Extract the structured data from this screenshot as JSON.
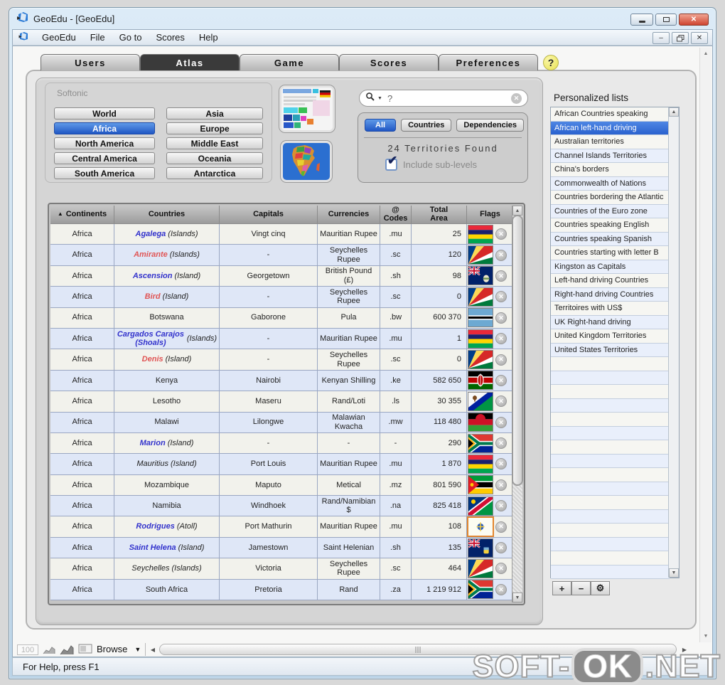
{
  "window": {
    "title": "GeoEdu - [GeoEdu]",
    "menu_items": [
      "GeoEdu",
      "File",
      "Go to",
      "Scores",
      "Help"
    ],
    "status_text": "For Help, press F1"
  },
  "tabs": [
    {
      "label": "Users",
      "active": false
    },
    {
      "label": "Atlas",
      "active": true
    },
    {
      "label": "Game",
      "active": false
    },
    {
      "label": "Scores",
      "active": false
    },
    {
      "label": "Preferences",
      "active": false
    }
  ],
  "help_label": "?",
  "atlas": {
    "brand_watermark": "Softonic",
    "regions": [
      {
        "label": "World",
        "selected": false
      },
      {
        "label": "Asia",
        "selected": false
      },
      {
        "label": "Africa",
        "selected": true
      },
      {
        "label": "Europe",
        "selected": false
      },
      {
        "label": "North America",
        "selected": false
      },
      {
        "label": "Middle East",
        "selected": false
      },
      {
        "label": "Central America",
        "selected": false
      },
      {
        "label": "Oceania",
        "selected": false
      },
      {
        "label": "South America",
        "selected": false
      },
      {
        "label": "Antarctica",
        "selected": false
      }
    ],
    "search": {
      "value": "?",
      "filters": [
        {
          "label": "All",
          "selected": true
        },
        {
          "label": "Countries",
          "selected": false
        },
        {
          "label": "Dependencies",
          "selected": false
        }
      ],
      "result_text": "24 Territories Found",
      "include_sublevels_label": "Include sub-levels",
      "include_sublevels_checked": true
    }
  },
  "table": {
    "sort_icon": "▲",
    "headers": [
      "Continents",
      "Countries",
      "Capitals",
      "Currencies",
      "@\nCodes",
      "Total\nArea",
      "Flags"
    ],
    "rows": [
      {
        "continent": "Africa",
        "name": "Agalega",
        "suffix": "(Islands)",
        "name_style": "blue",
        "capital": "Vingt cinq",
        "currency": "Mauritian Rupee",
        "code": ".mu",
        "area": "25",
        "flag": "mauritius"
      },
      {
        "continent": "Africa",
        "name": "Amirante",
        "suffix": "(Islands)",
        "name_style": "red",
        "capital": "-",
        "currency": "Seychelles Rupee",
        "code": ".sc",
        "area": "120",
        "flag": "seychelles"
      },
      {
        "continent": "Africa",
        "name": "Ascension",
        "suffix": "(Island)",
        "name_style": "blue",
        "capital": "Georgetown",
        "currency": "British Pound (£)",
        "code": ".sh",
        "area": "98",
        "flag": "ascension"
      },
      {
        "continent": "Africa",
        "name": "Bird",
        "suffix": "(Island)",
        "name_style": "red",
        "capital": "-",
        "currency": "Seychelles Rupee",
        "code": ".sc",
        "area": "0",
        "flag": "seychelles"
      },
      {
        "continent": "Africa",
        "name": "Botswana",
        "suffix": "",
        "name_style": "plain",
        "capital": "Gaborone",
        "currency": "Pula",
        "code": ".bw",
        "area": "600 370",
        "flag": "botswana"
      },
      {
        "continent": "Africa",
        "name": "Cargados Carajos (Shoals)",
        "suffix": "(Islands)",
        "name_style": "blue",
        "capital": "-",
        "currency": "Mauritian Rupee",
        "code": ".mu",
        "area": "1",
        "flag": "mauritius"
      },
      {
        "continent": "Africa",
        "name": "Denis",
        "suffix": "(Island)",
        "name_style": "red",
        "capital": "-",
        "currency": "Seychelles Rupee",
        "code": ".sc",
        "area": "0",
        "flag": "seychelles"
      },
      {
        "continent": "Africa",
        "name": "Kenya",
        "suffix": "",
        "name_style": "plain",
        "capital": "Nairobi",
        "currency": "Kenyan Shilling",
        "code": ".ke",
        "area": "582 650",
        "flag": "kenya"
      },
      {
        "continent": "Africa",
        "name": "Lesotho",
        "suffix": "",
        "name_style": "plain",
        "capital": "Maseru",
        "currency": "Rand/Loti",
        "code": ".ls",
        "area": "30 355",
        "flag": "lesotho"
      },
      {
        "continent": "Africa",
        "name": "Malawi",
        "suffix": "",
        "name_style": "plain",
        "capital": "Lilongwe",
        "currency": "Malawian Kwacha",
        "code": ".mw",
        "area": "118 480",
        "flag": "malawi"
      },
      {
        "continent": "Africa",
        "name": "Marion",
        "suffix": "(Island)",
        "name_style": "blue",
        "capital": "-",
        "currency": "-",
        "code": "-",
        "area": "290",
        "flag": "south-africa"
      },
      {
        "continent": "Africa",
        "name": "Mauritius",
        "suffix": "(Island)",
        "name_style": "blackital",
        "capital": "Port Louis",
        "currency": "Mauritian Rupee",
        "code": ".mu",
        "area": "1 870",
        "flag": "mauritius"
      },
      {
        "continent": "Africa",
        "name": "Mozambique",
        "suffix": "",
        "name_style": "plain",
        "capital": "Maputo",
        "currency": "Metical",
        "code": ".mz",
        "area": "801 590",
        "flag": "mozambique"
      },
      {
        "continent": "Africa",
        "name": "Namibia",
        "suffix": "",
        "name_style": "plain",
        "capital": "Windhoek",
        "currency": "Rand/Namibian $",
        "code": ".na",
        "area": "825 418",
        "flag": "namibia"
      },
      {
        "continent": "Africa",
        "name": "Rodrigues",
        "suffix": "(Atoll)",
        "name_style": "blue",
        "capital": "Port Mathurin",
        "currency": "Mauritian Rupee",
        "code": ".mu",
        "area": "108",
        "flag": "rodrigues",
        "flag_highlight": true
      },
      {
        "continent": "Africa",
        "name": "Saint Helena",
        "suffix": "(Island)",
        "name_style": "blue",
        "capital": "Jamestown",
        "currency": "Saint Helenian",
        "code": ".sh",
        "area": "135",
        "flag": "saint-helena"
      },
      {
        "continent": "Africa",
        "name": "Seychelles",
        "suffix": "(Islands)",
        "name_style": "blackital",
        "capital": "Victoria",
        "currency": "Seychelles Rupee",
        "code": ".sc",
        "area": "464",
        "flag": "seychelles"
      },
      {
        "continent": "Africa",
        "name": "South Africa",
        "suffix": "",
        "name_style": "plain",
        "capital": "Pretoria",
        "currency": "Rand",
        "code": ".za",
        "area": "1 219 912",
        "flag": "south-africa"
      }
    ]
  },
  "personalized_lists": {
    "title": "Personalized lists",
    "items": [
      {
        "label": "African Countries speaking",
        "selected": false
      },
      {
        "label": "African left-hand driving",
        "selected": true
      },
      {
        "label": "Australian territories",
        "selected": false
      },
      {
        "label": "Channel Islands Territories",
        "selected": false
      },
      {
        "label": "China's borders",
        "selected": false
      },
      {
        "label": "Commonwealth of Nations",
        "selected": false
      },
      {
        "label": "Countries bordering the Atlantic",
        "selected": false
      },
      {
        "label": "Countries of the Euro zone",
        "selected": false
      },
      {
        "label": "Countries speaking English",
        "selected": false
      },
      {
        "label": "Countries speaking Spanish",
        "selected": false
      },
      {
        "label": "Countries starting with letter B",
        "selected": false
      },
      {
        "label": "Kingston as Capitals",
        "selected": false
      },
      {
        "label": "Left-hand driving Countries",
        "selected": false
      },
      {
        "label": "Right-hand driving Countries",
        "selected": false
      },
      {
        "label": "Territoires with US$",
        "selected": false
      },
      {
        "label": "UK Right-hand driving",
        "selected": false
      },
      {
        "label": "United Kingdom Territories",
        "selected": false
      },
      {
        "label": "United States Territories",
        "selected": false
      }
    ],
    "empty_row_count": 16,
    "buttons": {
      "add": "+",
      "remove": "−",
      "settings": "⚙"
    }
  },
  "bottom_bar": {
    "zoom_value": "100",
    "browse_label": "Browse"
  },
  "watermark": {
    "prefix": "SOFT-",
    "badge": "OK",
    "suffix": ".NET"
  },
  "colors": {
    "accent_blue": "#2057c4",
    "tab_active": "#3a3a3a",
    "country_link_blue": "#3232cc",
    "country_link_red": "#e05555",
    "selected_list_blue": "#2a62ce"
  }
}
